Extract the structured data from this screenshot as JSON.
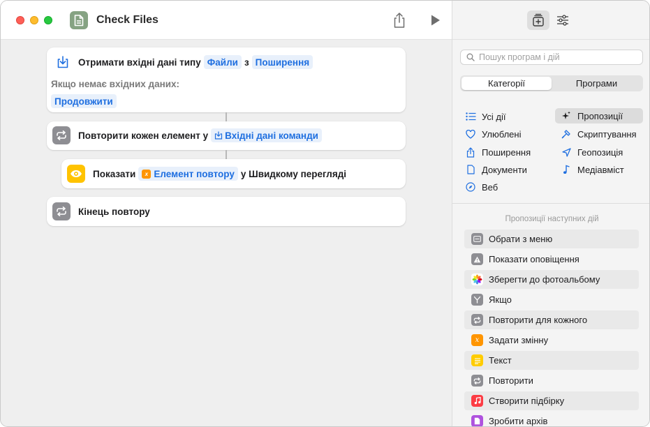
{
  "window": {
    "title": "Check Files"
  },
  "colors": {
    "blue_token": "#1f6fe0",
    "token_bg": "#e8f0fb",
    "gray_icon": "#8e8e93",
    "yellow_icon": "#ffc300"
  },
  "workflow": {
    "receive": {
      "prefix": "Отримати вхідні дані типу",
      "type_token": "Файли",
      "middle": "з",
      "source_token": "Поширення",
      "no_input_label": "Якщо немає вхідних даних:",
      "no_input_token": "Продовжити"
    },
    "repeat": {
      "prefix": "Повторити кожен елемент у",
      "token": "Вхідні дані команди"
    },
    "show": {
      "prefix": "Показати",
      "token": "Елемент повтору",
      "suffix": "у Швидкому перегляді"
    },
    "end_repeat": {
      "label": "Кінець повтору"
    }
  },
  "sidebar": {
    "search_placeholder": "Пошук програм і дій",
    "segments": [
      "Категорії",
      "Програми"
    ],
    "categories_left": [
      {
        "label": "Усі дії",
        "icon": "list-icon"
      },
      {
        "label": "Улюблені",
        "icon": "heart-icon"
      },
      {
        "label": "Поширення",
        "icon": "share-icon"
      },
      {
        "label": "Документи",
        "icon": "document-icon"
      },
      {
        "label": "Веб",
        "icon": "compass-icon"
      }
    ],
    "categories_right": [
      {
        "label": "Пропозиції",
        "icon": "sparkle-icon"
      },
      {
        "label": "Скриптування",
        "icon": "scripting-icon"
      },
      {
        "label": "Геопозиція",
        "icon": "location-icon"
      },
      {
        "label": "Медіавміст",
        "icon": "music-note-icon"
      }
    ],
    "suggestions_title": "Пропозиції наступних дій",
    "suggestions": [
      {
        "label": "Обрати з меню",
        "icon": "menu-icon",
        "color": "#8e8e93"
      },
      {
        "label": "Показати оповіщення",
        "icon": "alert-icon",
        "color": "#8e8e93"
      },
      {
        "label": "Зберегти до фотоальбому",
        "icon": "photos-icon",
        "color": "#ffffff"
      },
      {
        "label": "Якщо",
        "icon": "branch-icon",
        "color": "#8e8e93"
      },
      {
        "label": "Повторити для кожного",
        "icon": "repeat-icon",
        "color": "#8e8e93"
      },
      {
        "label": "Задати змінну",
        "icon": "variable-icon",
        "color": "#ff9500"
      },
      {
        "label": "Текст",
        "icon": "text-icon",
        "color": "#ffcc00"
      },
      {
        "label": "Повторити",
        "icon": "repeat-icon",
        "color": "#8e8e93"
      },
      {
        "label": "Створити підбірку",
        "icon": "music-icon",
        "color": "#fc3c44"
      },
      {
        "label": "Зробити архів",
        "icon": "archive-icon",
        "color": "#af52de"
      }
    ]
  }
}
